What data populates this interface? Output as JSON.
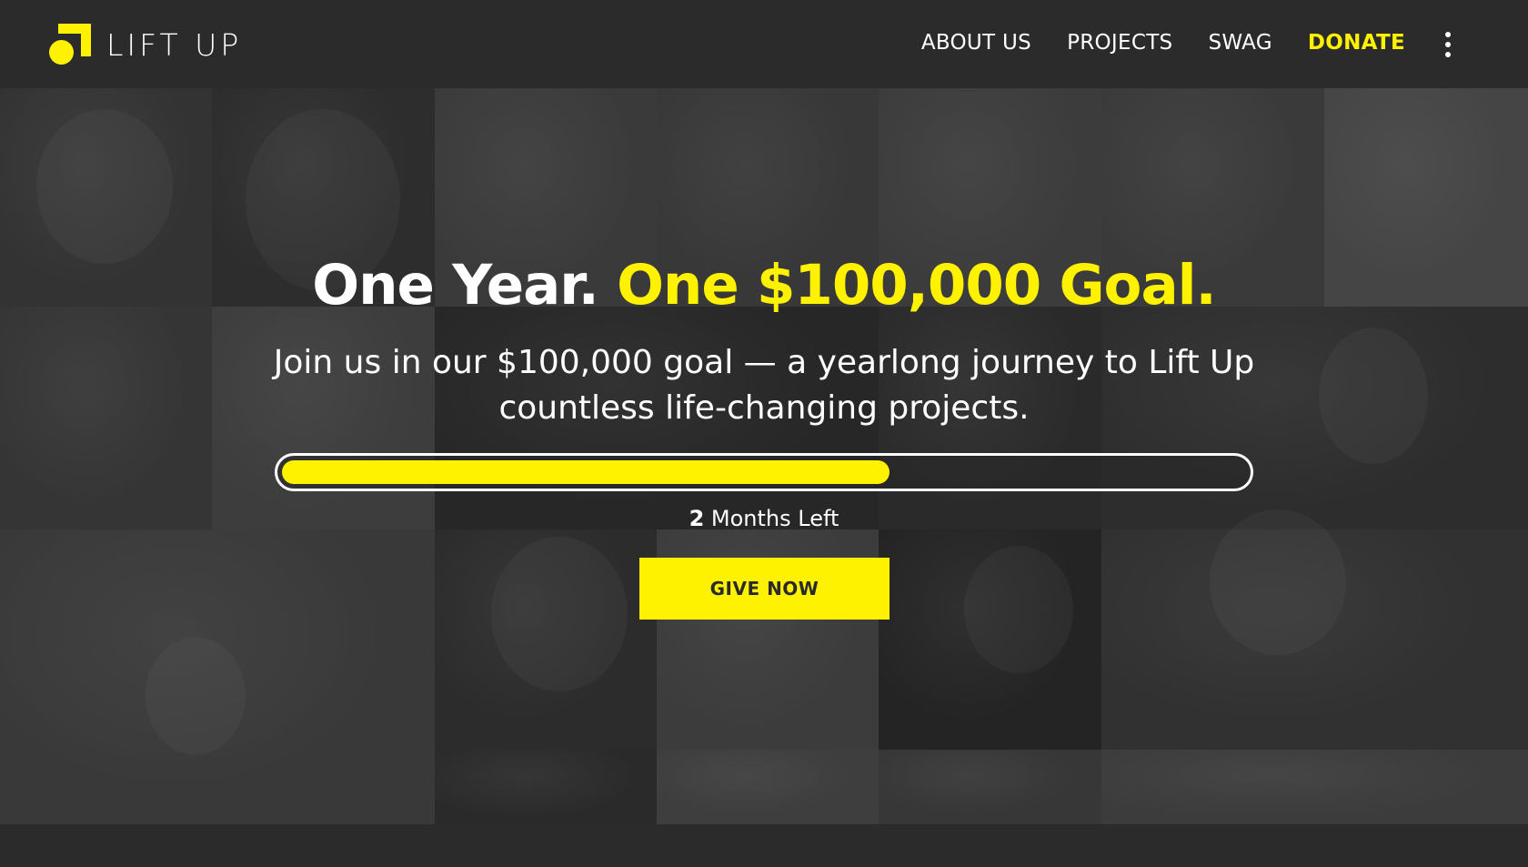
{
  "brand": {
    "logo_icon": "lift-up-logo-mark",
    "name": "LIFT UP",
    "accent_color": "#fff200"
  },
  "nav": {
    "items": [
      {
        "label": "ABOUT US"
      },
      {
        "label": "PROJECTS"
      },
      {
        "label": "SWAG"
      }
    ],
    "donate_label": "DONATE",
    "more_icon": "kebab-menu-icon"
  },
  "hero": {
    "title_white": "One Year.",
    "title_accent": "One $100,000 Goal.",
    "subtitle": "Join us in our $100,000 goal — a yearlong journey to Lift Up countless life-changing projects.",
    "progress_fraction": 0.63,
    "months_number": "2",
    "months_text": "Months Left",
    "cta_label": "GIVE NOW"
  }
}
